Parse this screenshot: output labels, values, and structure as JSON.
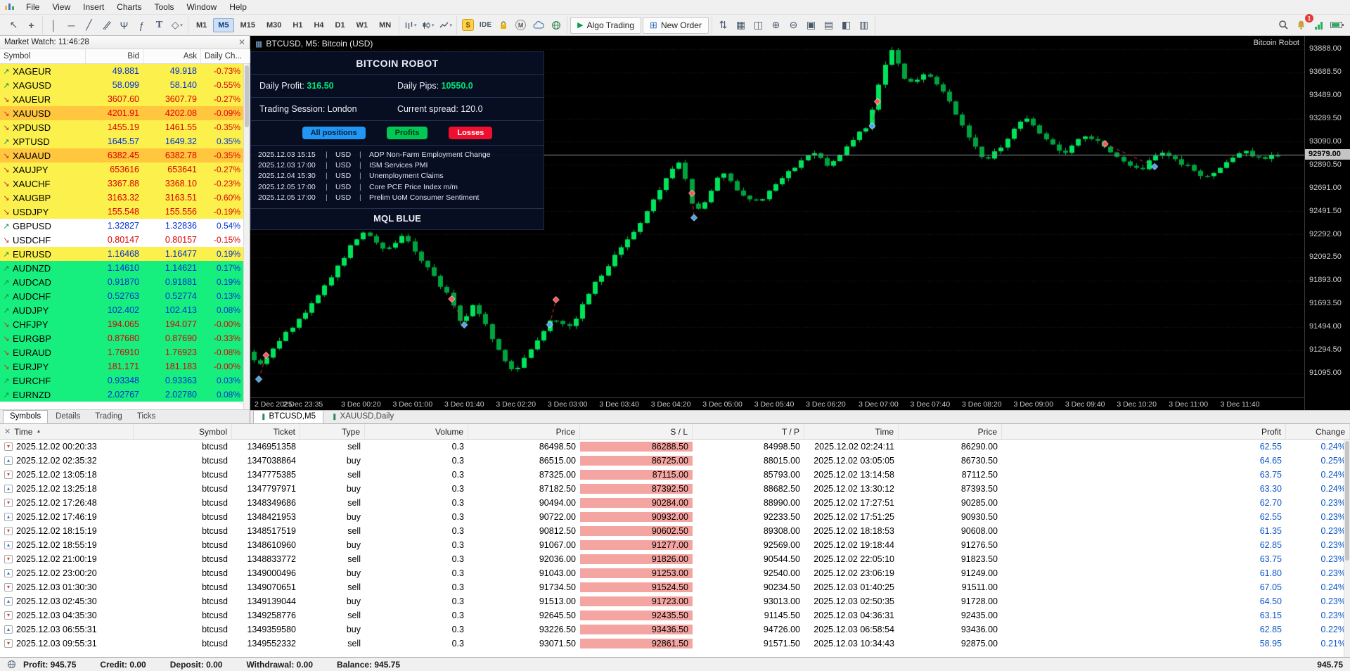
{
  "menu": {
    "items": [
      "File",
      "View",
      "Insert",
      "Charts",
      "Tools",
      "Window",
      "Help"
    ]
  },
  "toolbar": {
    "timeframes": [
      "M1",
      "M5",
      "M15",
      "M30",
      "H1",
      "H4",
      "D1",
      "W1",
      "MN"
    ],
    "active_timeframe": "M5",
    "ide_label": "IDE",
    "algo_trading_label": "Algo Trading",
    "new_order_label": "New Order",
    "notification_count": "1"
  },
  "market_watch": {
    "title": "Market Watch: 11:46:28",
    "columns": [
      "Symbol",
      "Bid",
      "Ask",
      "Daily Ch..."
    ],
    "rows": [
      {
        "symbol": "XAGEUR",
        "bid": "49.881",
        "ask": "49.918",
        "change": "-0.73%",
        "dir": "up",
        "bg": "yellow"
      },
      {
        "symbol": "XAGUSD",
        "bid": "58.099",
        "ask": "58.140",
        "change": "-0.55%",
        "dir": "up",
        "bg": "yellow"
      },
      {
        "symbol": "XAUEUR",
        "bid": "3607.60",
        "ask": "3607.79",
        "change": "-0.27%",
        "dir": "down",
        "bg": "yellow"
      },
      {
        "symbol": "XAUUSD",
        "bid": "4201.91",
        "ask": "4202.08",
        "change": "-0.09%",
        "dir": "down",
        "bg": "gold"
      },
      {
        "symbol": "XPDUSD",
        "bid": "1455.19",
        "ask": "1461.55",
        "change": "-0.35%",
        "dir": "down",
        "bg": "yellow"
      },
      {
        "symbol": "XPTUSD",
        "bid": "1645.57",
        "ask": "1649.32",
        "change": "0.35%",
        "dir": "up",
        "bg": "yellow"
      },
      {
        "symbol": "XAUAUD",
        "bid": "6382.45",
        "ask": "6382.78",
        "change": "-0.35%",
        "dir": "down",
        "bg": "gold"
      },
      {
        "symbol": "XAUJPY",
        "bid": "653616",
        "ask": "653641",
        "change": "-0.27%",
        "dir": "down",
        "bg": "yellow"
      },
      {
        "symbol": "XAUCHF",
        "bid": "3367.88",
        "ask": "3368.10",
        "change": "-0.23%",
        "dir": "down",
        "bg": "yellow"
      },
      {
        "symbol": "XAUGBP",
        "bid": "3163.32",
        "ask": "3163.51",
        "change": "-0.60%",
        "dir": "down",
        "bg": "yellow"
      },
      {
        "symbol": "USDJPY",
        "bid": "155.548",
        "ask": "155.556",
        "change": "-0.19%",
        "dir": "down",
        "bg": "yellow"
      },
      {
        "symbol": "GBPUSD",
        "bid": "1.32827",
        "ask": "1.32836",
        "change": "0.54%",
        "dir": "up",
        "bg": "white"
      },
      {
        "symbol": "USDCHF",
        "bid": "0.80147",
        "ask": "0.80157",
        "change": "-0.15%",
        "dir": "down",
        "bg": "white"
      },
      {
        "symbol": "EURUSD",
        "bid": "1.16468",
        "ask": "1.16477",
        "change": "0.19%",
        "dir": "up",
        "bg": "yellow"
      },
      {
        "symbol": "AUDNZD",
        "bid": "1.14610",
        "ask": "1.14621",
        "change": "0.17%",
        "dir": "up",
        "bg": "green"
      },
      {
        "symbol": "AUDCAD",
        "bid": "0.91870",
        "ask": "0.91881",
        "change": "0.19%",
        "dir": "up",
        "bg": "green"
      },
      {
        "symbol": "AUDCHF",
        "bid": "0.52763",
        "ask": "0.52774",
        "change": "0.13%",
        "dir": "up",
        "bg": "green"
      },
      {
        "symbol": "AUDJPY",
        "bid": "102.402",
        "ask": "102.413",
        "change": "0.08%",
        "dir": "up",
        "bg": "green"
      },
      {
        "symbol": "CHFJPY",
        "bid": "194.065",
        "ask": "194.077",
        "change": "-0.00%",
        "dir": "down",
        "bg": "green"
      },
      {
        "symbol": "EURGBP",
        "bid": "0.87680",
        "ask": "0.87690",
        "change": "-0.33%",
        "dir": "down",
        "bg": "green"
      },
      {
        "symbol": "EURAUD",
        "bid": "1.76910",
        "ask": "1.76923",
        "change": "-0.08%",
        "dir": "down",
        "bg": "green"
      },
      {
        "symbol": "EURJPY",
        "bid": "181.171",
        "ask": "181.183",
        "change": "-0.00%",
        "dir": "down",
        "bg": "green"
      },
      {
        "symbol": "EURCHF",
        "bid": "0.93348",
        "ask": "0.93363",
        "change": "0.03%",
        "dir": "up",
        "bg": "green"
      },
      {
        "symbol": "EURNZD",
        "bid": "2.02767",
        "ask": "2.02780",
        "change": "0.08%",
        "dir": "up",
        "bg": "green"
      }
    ],
    "tabs": [
      "Symbols",
      "Details",
      "Trading",
      "Ticks"
    ],
    "active_tab": "Symbols"
  },
  "chart": {
    "title": "BTCUSD, M5: Bitcoin (USD)",
    "corner_label": "Bitcoin Robot",
    "tabs": [
      {
        "label": "BTCUSD,M5",
        "active": true
      },
      {
        "label": "XAUUSD,Daily",
        "active": false
      }
    ],
    "current_price": "92979.00",
    "price_axis": [
      "93888.00",
      "93688.50",
      "93489.00",
      "93289.50",
      "93090.00",
      "92890.50",
      "92691.00",
      "92491.50",
      "92292.00",
      "92092.50",
      "91893.00",
      "91693.50",
      "91494.00",
      "91294.50",
      "91095.00"
    ],
    "time_axis": [
      {
        "f": 0.004,
        "label": "2 Dec 2025"
      },
      {
        "f": 0.05,
        "label": "2 Dec 23:35"
      },
      {
        "f": 0.105,
        "label": "3 Dec 00:20"
      },
      {
        "f": 0.154,
        "label": "3 Dec 01:00"
      },
      {
        "f": 0.203,
        "label": "3 Dec 01:40"
      },
      {
        "f": 0.252,
        "label": "3 Dec 02:20"
      },
      {
        "f": 0.301,
        "label": "3 Dec 03:00"
      },
      {
        "f": 0.35,
        "label": "3 Dec 03:40"
      },
      {
        "f": 0.399,
        "label": "3 Dec 04:20"
      },
      {
        "f": 0.448,
        "label": "3 Dec 05:00"
      },
      {
        "f": 0.497,
        "label": "3 Dec 05:40"
      },
      {
        "f": 0.546,
        "label": "3 Dec 06:20"
      },
      {
        "f": 0.596,
        "label": "3 Dec 07:00"
      },
      {
        "f": 0.645,
        "label": "3 Dec 07:40"
      },
      {
        "f": 0.694,
        "label": "3 Dec 08:20"
      },
      {
        "f": 0.743,
        "label": "3 Dec 09:00"
      },
      {
        "f": 0.792,
        "label": "3 Dec 09:40"
      },
      {
        "f": 0.841,
        "label": "3 Dec 10:20"
      },
      {
        "f": 0.89,
        "label": "3 Dec 11:00"
      },
      {
        "f": 0.939,
        "label": "3 Dec 11:40"
      }
    ],
    "robot_panel": {
      "title": "BITCOIN ROBOT",
      "daily_profit_label": "Daily Profit: ",
      "daily_profit": "316.50",
      "daily_pips_label": "Daily Pips: ",
      "daily_pips": "10550.0",
      "session_label": "Trading Session: London",
      "spread_label": "Current spread: 120.0",
      "buttons": [
        {
          "label": "All positions",
          "color": "#2196F3",
          "tc": "#06203F"
        },
        {
          "label": "Profits",
          "color": "#00C853",
          "tc": "#063A1C"
        },
        {
          "label": "Losses",
          "color": "#EF0F2E",
          "tc": "#FFFFFF"
        }
      ],
      "calendar": [
        {
          "time": "2025.12.03 15:15",
          "cur": "USD",
          "event": "ADP Non-Farm Employment Change"
        },
        {
          "time": "2025.12.03 17:00",
          "cur": "USD",
          "event": "ISM Services PMI"
        },
        {
          "time": "2025.12.04 15:30",
          "cur": "USD",
          "event": "Unemployment Claims"
        },
        {
          "time": "2025.12.05 17:00",
          "cur": "USD",
          "event": "Core PCE Price Index m/m"
        },
        {
          "time": "2025.12.05 17:00",
          "cur": "USD",
          "event": "Prelim UoM Consumer Sentiment"
        }
      ],
      "footer": "MQL BLUE"
    },
    "chart_data": {
      "type": "candlestick",
      "symbol": "BTCUSD",
      "timeframe": "M5",
      "y_top_price": 94002,
      "y_bottom_price": 90886,
      "current_price": 92979.0,
      "price_path": [
        [
          0.0,
          91280
        ],
        [
          0.013,
          91150
        ],
        [
          0.032,
          91400
        ],
        [
          0.056,
          91620
        ],
        [
          0.081,
          91950
        ],
        [
          0.099,
          92200
        ],
        [
          0.112,
          92330
        ],
        [
          0.13,
          92140
        ],
        [
          0.148,
          92280
        ],
        [
          0.167,
          92050
        ],
        [
          0.191,
          91760
        ],
        [
          0.203,
          91530
        ],
        [
          0.215,
          91700
        ],
        [
          0.228,
          91480
        ],
        [
          0.24,
          91260
        ],
        [
          0.252,
          91100
        ],
        [
          0.271,
          91330
        ],
        [
          0.289,
          91580
        ],
        [
          0.307,
          91500
        ],
        [
          0.326,
          91820
        ],
        [
          0.35,
          92120
        ],
        [
          0.375,
          92420
        ],
        [
          0.399,
          92800
        ],
        [
          0.412,
          92950
        ],
        [
          0.419,
          92620
        ],
        [
          0.424,
          92480
        ],
        [
          0.437,
          92600
        ],
        [
          0.449,
          92840
        ],
        [
          0.467,
          92660
        ],
        [
          0.485,
          92560
        ],
        [
          0.51,
          92800
        ],
        [
          0.534,
          93000
        ],
        [
          0.553,
          92880
        ],
        [
          0.571,
          93080
        ],
        [
          0.59,
          93240
        ],
        [
          0.602,
          93700
        ],
        [
          0.611,
          93880
        ],
        [
          0.627,
          93580
        ],
        [
          0.645,
          93680
        ],
        [
          0.664,
          93460
        ],
        [
          0.682,
          93180
        ],
        [
          0.7,
          92920
        ],
        [
          0.719,
          93080
        ],
        [
          0.737,
          93320
        ],
        [
          0.755,
          93140
        ],
        [
          0.774,
          92980
        ],
        [
          0.792,
          93140
        ],
        [
          0.811,
          93070
        ],
        [
          0.829,
          92940
        ],
        [
          0.847,
          92840
        ],
        [
          0.865,
          92990
        ],
        [
          0.89,
          92890
        ],
        [
          0.908,
          92760
        ],
        [
          0.926,
          92900
        ],
        [
          0.945,
          93010
        ],
        [
          0.963,
          92940
        ],
        [
          0.975,
          92979
        ]
      ],
      "markers": [
        {
          "f": 0.008,
          "p": 91043,
          "side": "buy"
        },
        {
          "f": 0.015,
          "p": 91249,
          "side": "sell"
        },
        {
          "f": 0.191,
          "p": 91734,
          "side": "sell"
        },
        {
          "f": 0.203,
          "p": 91511,
          "side": "buy"
        },
        {
          "f": 0.284,
          "p": 91513,
          "side": "buy"
        },
        {
          "f": 0.29,
          "p": 91728,
          "side": "sell"
        },
        {
          "f": 0.419,
          "p": 92645,
          "side": "sell"
        },
        {
          "f": 0.421,
          "p": 92435,
          "side": "buy"
        },
        {
          "f": 0.59,
          "p": 93226,
          "side": "buy"
        },
        {
          "f": 0.595,
          "p": 93436,
          "side": "sell"
        },
        {
          "f": 0.811,
          "p": 93071,
          "side": "sell"
        },
        {
          "f": 0.858,
          "p": 92875,
          "side": "buy"
        }
      ]
    }
  },
  "history": {
    "columns": [
      "Time",
      "Symbol",
      "Ticket",
      "Type",
      "Volume",
      "Price",
      "S / L",
      "T / P",
      "Time",
      "Price",
      "Profit",
      "Change"
    ],
    "rows": [
      {
        "open_time": "2025.12.02 00:20:33",
        "symbol": "btcusd",
        "ticket": "1346951358",
        "type": "sell",
        "volume": "0.3",
        "open_price": "86498.50",
        "sl": "86288.50",
        "tp": "84998.50",
        "close_time": "2025.12.02 02:24:11",
        "close_price": "86290.00",
        "profit": "62.55",
        "change": "0.24%"
      },
      {
        "open_time": "2025.12.02 02:35:32",
        "symbol": "btcusd",
        "ticket": "1347038864",
        "type": "buy",
        "volume": "0.3",
        "open_price": "86515.00",
        "sl": "86725.00",
        "tp": "88015.00",
        "close_time": "2025.12.02 03:05:05",
        "close_price": "86730.50",
        "profit": "64.65",
        "change": "0.25%"
      },
      {
        "open_time": "2025.12.02 13:05:18",
        "symbol": "btcusd",
        "ticket": "1347775385",
        "type": "sell",
        "volume": "0.3",
        "open_price": "87325.00",
        "sl": "87115.00",
        "tp": "85793.00",
        "close_time": "2025.12.02 13:14:58",
        "close_price": "87112.50",
        "profit": "63.75",
        "change": "0.24%"
      },
      {
        "open_time": "2025.12.02 13:25:18",
        "symbol": "btcusd",
        "ticket": "1347797971",
        "type": "buy",
        "volume": "0.3",
        "open_price": "87182.50",
        "sl": "87392.50",
        "tp": "88682.50",
        "close_time": "2025.12.02 13:30:12",
        "close_price": "87393.50",
        "profit": "63.30",
        "change": "0.24%"
      },
      {
        "open_time": "2025.12.02 17:26:48",
        "symbol": "btcusd",
        "ticket": "1348349686",
        "type": "sell",
        "volume": "0.3",
        "open_price": "90494.00",
        "sl": "90284.00",
        "tp": "88990.00",
        "close_time": "2025.12.02 17:27:51",
        "close_price": "90285.00",
        "profit": "62.70",
        "change": "0.23%"
      },
      {
        "open_time": "2025.12.02 17:46:19",
        "symbol": "btcusd",
        "ticket": "1348421953",
        "type": "buy",
        "volume": "0.3",
        "open_price": "90722.00",
        "sl": "90932.00",
        "tp": "92233.50",
        "close_time": "2025.12.02 17:51:25",
        "close_price": "90930.50",
        "profit": "62.55",
        "change": "0.23%"
      },
      {
        "open_time": "2025.12.02 18:15:19",
        "symbol": "btcusd",
        "ticket": "1348517519",
        "type": "sell",
        "volume": "0.3",
        "open_price": "90812.50",
        "sl": "90602.50",
        "tp": "89308.00",
        "close_time": "2025.12.02 18:18:53",
        "close_price": "90608.00",
        "profit": "61.35",
        "change": "0.23%"
      },
      {
        "open_time": "2025.12.02 18:55:19",
        "symbol": "btcusd",
        "ticket": "1348610960",
        "type": "buy",
        "volume": "0.3",
        "open_price": "91067.00",
        "sl": "91277.00",
        "tp": "92569.00",
        "close_time": "2025.12.02 19:18:44",
        "close_price": "91276.50",
        "profit": "62.85",
        "change": "0.23%"
      },
      {
        "open_time": "2025.12.02 21:00:19",
        "symbol": "btcusd",
        "ticket": "1348833772",
        "type": "sell",
        "volume": "0.3",
        "open_price": "92036.00",
        "sl": "91826.00",
        "tp": "90544.50",
        "close_time": "2025.12.02 22:05:10",
        "close_price": "91823.50",
        "profit": "63.75",
        "change": "0.23%"
      },
      {
        "open_time": "2025.12.02 23:00:20",
        "symbol": "btcusd",
        "ticket": "1349000496",
        "type": "buy",
        "volume": "0.3",
        "open_price": "91043.00",
        "sl": "91253.00",
        "tp": "92540.00",
        "close_time": "2025.12.02 23:06:19",
        "close_price": "91249.00",
        "profit": "61.80",
        "change": "0.23%"
      },
      {
        "open_time": "2025.12.03 01:30:30",
        "symbol": "btcusd",
        "ticket": "1349070651",
        "type": "sell",
        "volume": "0.3",
        "open_price": "91734.50",
        "sl": "91524.50",
        "tp": "90234.50",
        "close_time": "2025.12.03 01:40:25",
        "close_price": "91511.00",
        "profit": "67.05",
        "change": "0.24%"
      },
      {
        "open_time": "2025.12.03 02:45:30",
        "symbol": "btcusd",
        "ticket": "1349139044",
        "type": "buy",
        "volume": "0.3",
        "open_price": "91513.00",
        "sl": "91723.00",
        "tp": "93013.00",
        "close_time": "2025.12.03 02:50:35",
        "close_price": "91728.00",
        "profit": "64.50",
        "change": "0.23%"
      },
      {
        "open_time": "2025.12.03 04:35:30",
        "symbol": "btcusd",
        "ticket": "1349258776",
        "type": "sell",
        "volume": "0.3",
        "open_price": "92645.50",
        "sl": "92435.50",
        "tp": "91145.50",
        "close_time": "2025.12.03 04:36:31",
        "close_price": "92435.00",
        "profit": "63.15",
        "change": "0.23%"
      },
      {
        "open_time": "2025.12.03 06:55:31",
        "symbol": "btcusd",
        "ticket": "1349359580",
        "type": "buy",
        "volume": "0.3",
        "open_price": "93226.50",
        "sl": "93436.50",
        "tp": "94726.00",
        "close_time": "2025.12.03 06:58:54",
        "close_price": "93436.00",
        "profit": "62.85",
        "change": "0.22%"
      },
      {
        "open_time": "2025.12.03 09:55:31",
        "symbol": "btcusd",
        "ticket": "1349552332",
        "type": "sell",
        "volume": "0.3",
        "open_price": "93071.50",
        "sl": "92861.50",
        "tp": "91571.50",
        "close_time": "2025.12.03 10:34:43",
        "close_price": "92875.00",
        "profit": "58.95",
        "change": "0.21%"
      }
    ]
  },
  "status_bar": {
    "items": [
      "Profit: 945.75",
      "Credit: 0.00",
      "Deposit: 0.00",
      "Withdrawal: 0.00",
      "Balance: 945.75"
    ],
    "right_value": "945.75"
  }
}
